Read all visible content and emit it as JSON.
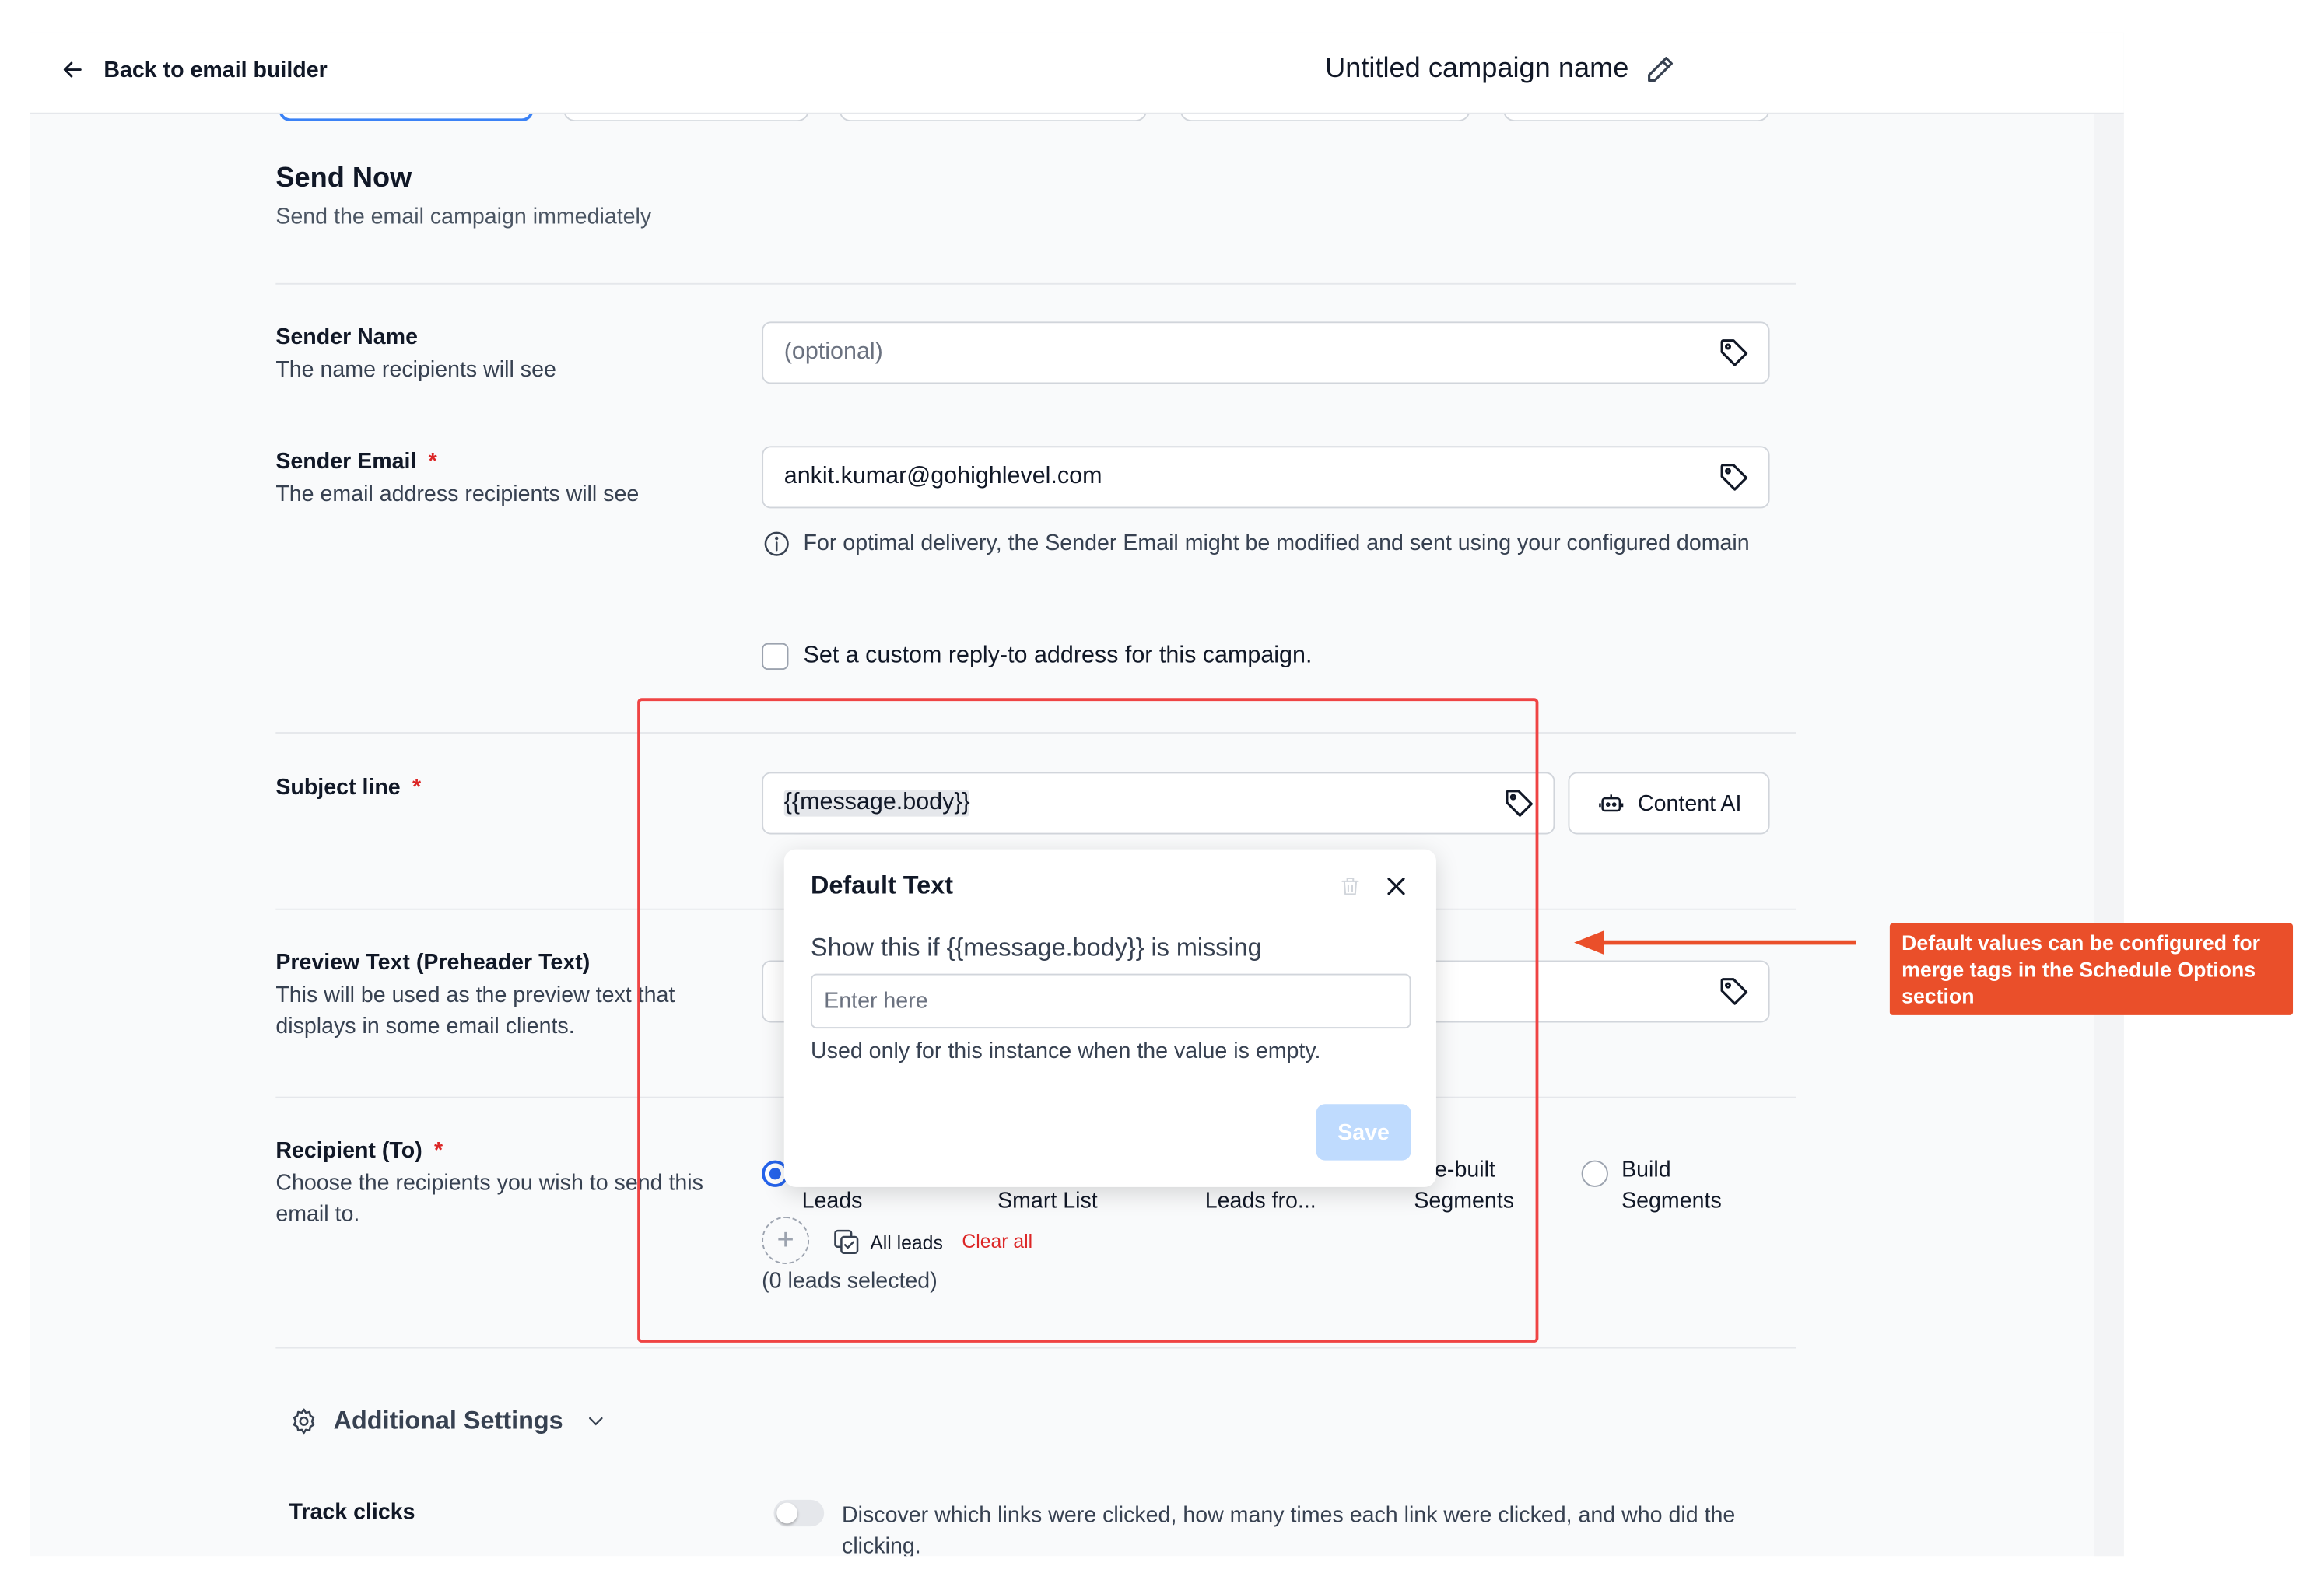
{
  "topbar": {
    "back_label": "Back to email builder",
    "campaign_name": "Untitled campaign name"
  },
  "send_now": {
    "title": "Send Now",
    "subtitle": "Send the email campaign immediately"
  },
  "sender_name": {
    "label": "Sender Name",
    "help": "The name recipients will see",
    "placeholder": "(optional)",
    "value": ""
  },
  "sender_email": {
    "label": "Sender Email",
    "required_mark": "*",
    "help": "The email address recipients will see",
    "value": "ankit.kumar@gohighlevel.com",
    "info": "For optimal delivery, the Sender Email might be modified and sent using your configured domain"
  },
  "reply_to": {
    "label": "Set a custom reply-to address for this campaign.",
    "checked": false
  },
  "subject": {
    "label": "Subject line",
    "required_mark": "*",
    "value": "{{message.body}}",
    "content_ai_label": "Content AI"
  },
  "preview_text": {
    "label": "Preview Text (Preheader Text)",
    "help": "This will be used as the preview text that displays in some email clients."
  },
  "recipient": {
    "label": "Recipient (To)",
    "required_mark": "*",
    "help": "Choose the recipients you wish to send this email to.",
    "options": [
      {
        "label": "Leads",
        "selected": true
      },
      {
        "label": "Smart List",
        "selected": false
      },
      {
        "label": "Leads fro...",
        "selected": false
      },
      {
        "label_line1": "e-built",
        "label_line2": "Segments",
        "selected": false
      },
      {
        "label_line1": "Build",
        "label_line2": "Segments",
        "selected": false
      }
    ],
    "all_leads_label": "All leads",
    "clear_all_label": "Clear all",
    "leads_selected": "(0 leads selected)"
  },
  "additional_settings": {
    "title": "Additional Settings",
    "track_clicks_label": "Track clicks",
    "track_clicks_on": false,
    "track_clicks_desc": "Discover which links were clicked, how many times each link were clicked, and who did the clicking."
  },
  "popover": {
    "title": "Default Text",
    "question": "Show this if {{message.body}} is missing",
    "input_placeholder": "Enter here",
    "input_value": "",
    "hint": "Used only for this instance when the value is empty.",
    "save_label": "Save"
  },
  "annotation": {
    "callout_text": "Default values can be configured for merge tags in the Schedule Options section",
    "accent_color": "#ea4f2a"
  },
  "colors": {
    "primary": "#2563eb",
    "required": "#dc2626",
    "save_disabled": "#bfdbfe"
  }
}
